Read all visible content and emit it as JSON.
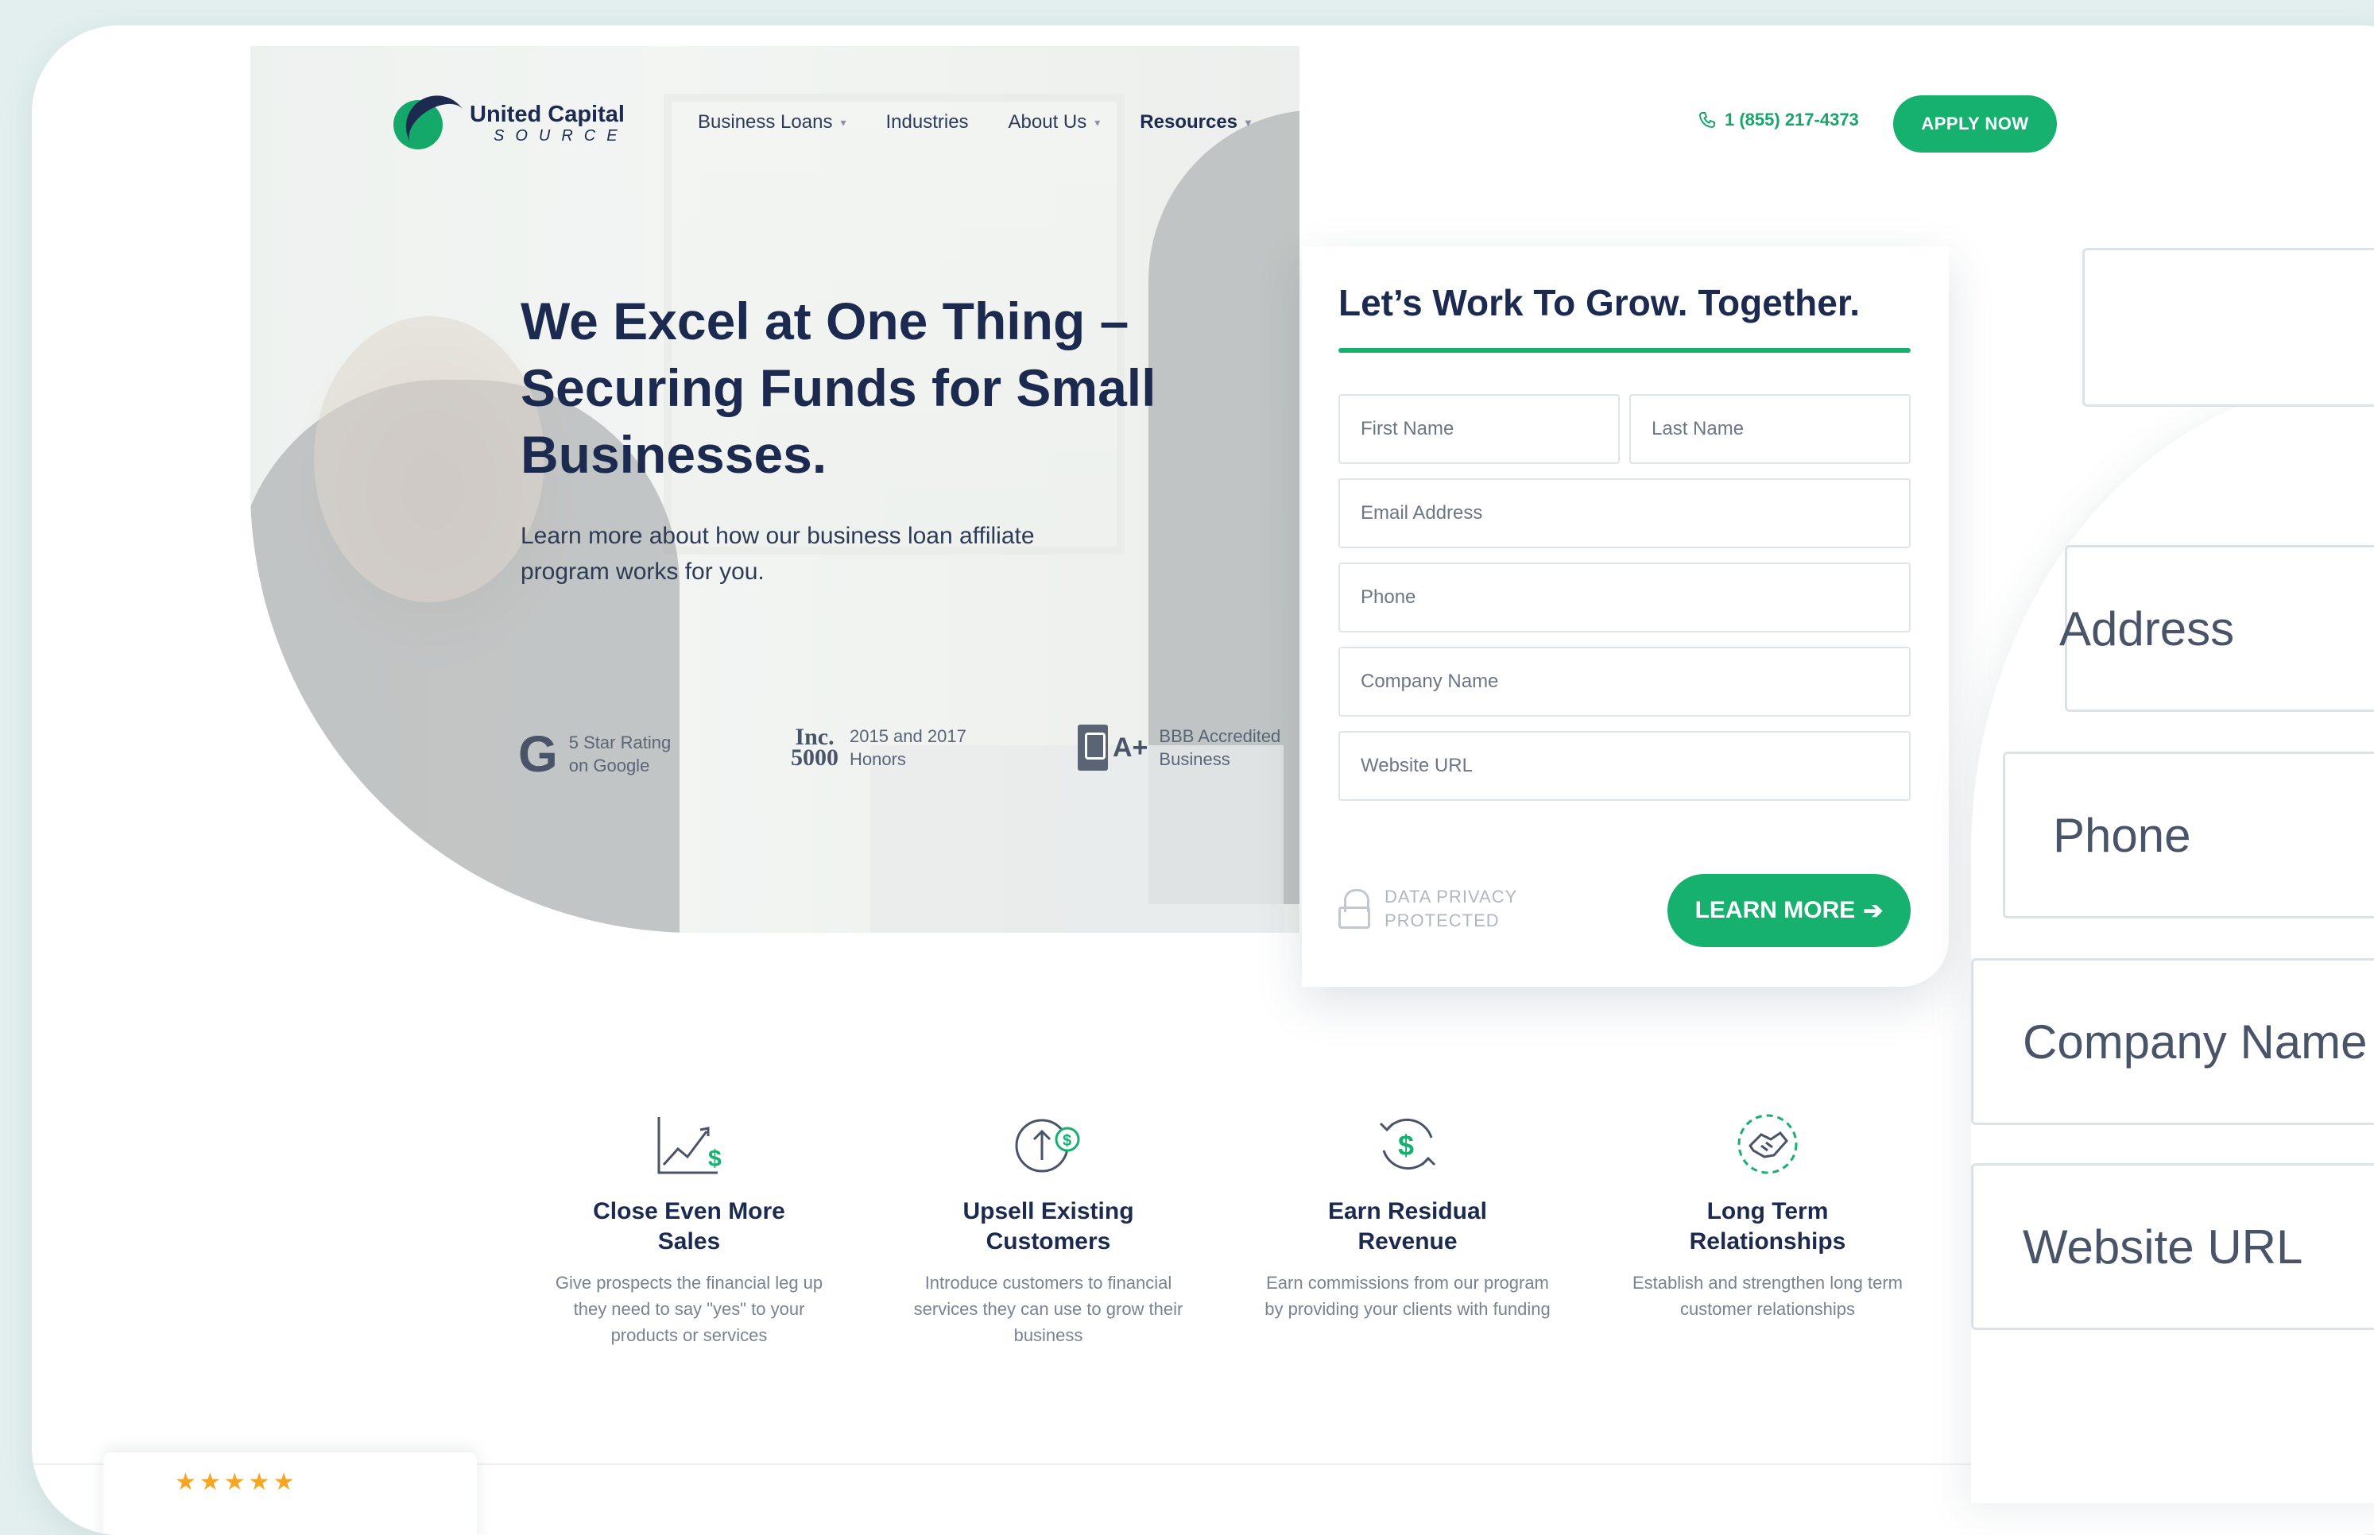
{
  "brand": {
    "name_line1": "United Capital",
    "name_line2": "SOURCE"
  },
  "nav": {
    "items": [
      {
        "label": "Business Loans",
        "has_dropdown": true
      },
      {
        "label": "Industries",
        "has_dropdown": false
      },
      {
        "label": "About Us",
        "has_dropdown": true
      },
      {
        "label": "Resources",
        "has_dropdown": true
      }
    ],
    "phone": "1 (855) 217-4373",
    "apply_label": "APPLY NOW"
  },
  "hero": {
    "title": "We Excel at One Thing – Securing Funds for Small Businesses.",
    "subtitle": "Learn more about how our business loan affiliate program works for you.",
    "badges": [
      {
        "mark": "G",
        "text_line1": "5 Star Rating",
        "text_line2": "on Google"
      },
      {
        "mark_line1": "Inc.",
        "mark_line2": "5000",
        "text_line1": "2015 and 2017",
        "text_line2": "Honors"
      },
      {
        "mark": "A+",
        "text_line1": "BBB Accredited",
        "text_line2": "Business"
      }
    ]
  },
  "form": {
    "title": "Let’s Work To Grow. Together.",
    "placeholders": {
      "first_name": "First Name",
      "last_name": "Last Name",
      "email": "Email Address",
      "phone": "Phone",
      "company": "Company Name",
      "website": "Website URL"
    },
    "privacy_line1": "DATA PRIVACY",
    "privacy_line2": "PROTECTED",
    "submit_label": "LEARN MORE",
    "submit_arrow": "➔"
  },
  "features": [
    {
      "icon": "growth-chart-dollar-icon",
      "title_line1": "Close Even More",
      "title_line2": "Sales",
      "desc": "Give prospects the financial leg up they need to say \"yes\" to your products or services"
    },
    {
      "icon": "upsell-arrow-dollar-icon",
      "title_line1": "Upsell Existing",
      "title_line2": "Customers",
      "desc": "Introduce customers to financial services they can use to grow their business"
    },
    {
      "icon": "recurring-dollar-icon",
      "title_line1": "Earn Residual",
      "title_line2": "Revenue",
      "desc": "Earn commissions from our program by providing your clients with funding"
    },
    {
      "icon": "handshake-icon",
      "title_line1": "Long Term",
      "title_line2": "Relationships",
      "desc": "Establish and strengthen long term customer relationships"
    }
  ],
  "review": {
    "stars": "★★★★★"
  },
  "zoom": {
    "fields": [
      "Address",
      "Phone",
      "Company Name",
      "Website URL"
    ]
  },
  "colors": {
    "accent": "#16b06f",
    "navy": "#1b2a4e",
    "background": "#e3efef"
  }
}
